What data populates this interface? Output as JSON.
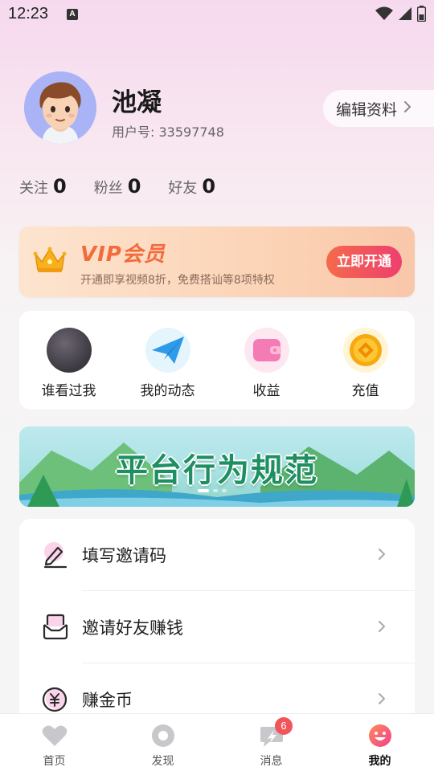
{
  "status_bar": {
    "time": "12:23",
    "notification_glyph": "A"
  },
  "profile": {
    "name": "池凝",
    "user_id": "用户号: 33597748",
    "edit_label": "编辑资料",
    "stats": [
      {
        "label": "关注",
        "value": "0"
      },
      {
        "label": "粉丝",
        "value": "0"
      },
      {
        "label": "好友",
        "value": "0"
      }
    ]
  },
  "vip": {
    "title": "VIP会员",
    "subtitle": "开通即享视频8折，免费搭讪等8项特权",
    "button": "立即开通"
  },
  "quick_actions": [
    {
      "label": "谁看过我",
      "icon": "visitor-avatar-icon"
    },
    {
      "label": "我的动态",
      "icon": "paper-plane-icon"
    },
    {
      "label": "收益",
      "icon": "wallet-icon"
    },
    {
      "label": "充值",
      "icon": "coin-icon"
    }
  ],
  "banner": {
    "title": "平台行为规范",
    "page_count": 3,
    "active_page": 0
  },
  "menu": [
    {
      "label": "填写邀请码",
      "icon": "pen-icon"
    },
    {
      "label": "邀请好友赚钱",
      "icon": "invite-envelope-icon"
    },
    {
      "label": "赚金币",
      "icon": "yuan-coin-icon"
    }
  ],
  "tabs": [
    {
      "label": "首页",
      "icon": "heart-icon",
      "active": false
    },
    {
      "label": "发现",
      "icon": "discover-icon",
      "active": false
    },
    {
      "label": "消息",
      "icon": "message-icon",
      "active": false,
      "badge": "6"
    },
    {
      "label": "我的",
      "icon": "smile-icon",
      "active": true
    }
  ],
  "colors": {
    "accent": "#f36a3b",
    "vip_button": "#ee3f6e",
    "badge": "#f2545b",
    "banner_text": "#1e8f62"
  }
}
